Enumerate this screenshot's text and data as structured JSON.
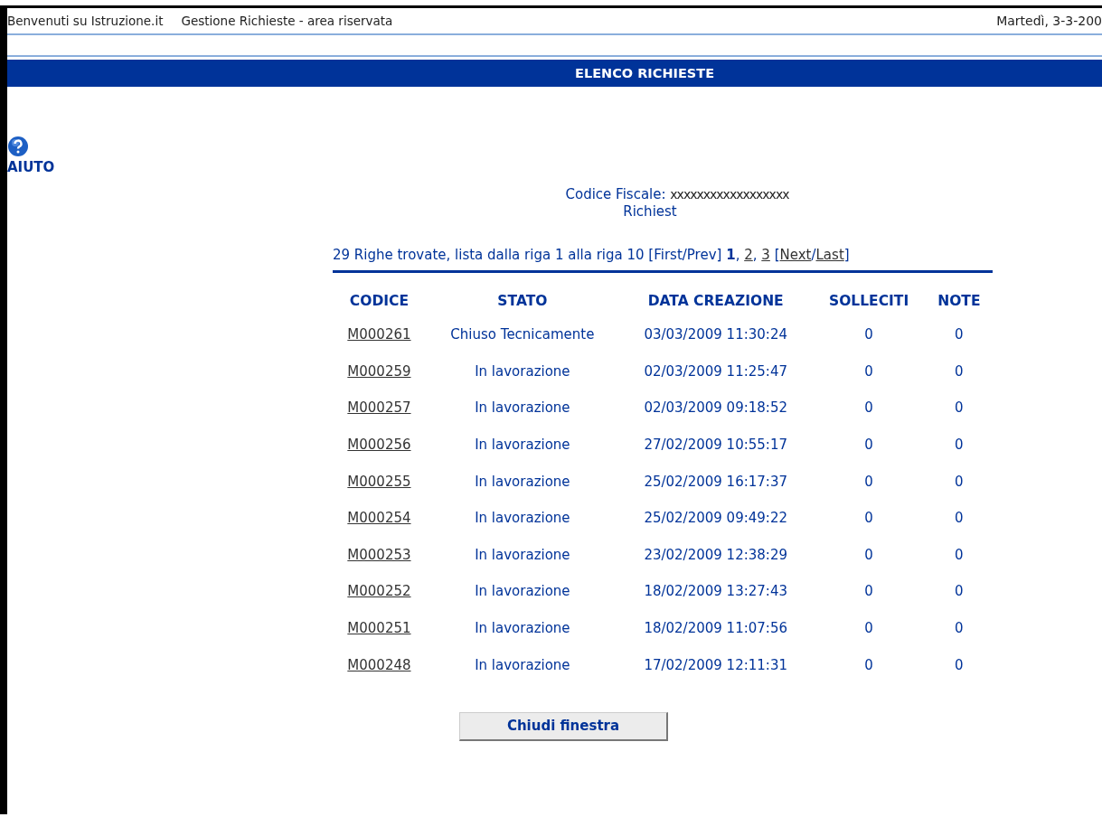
{
  "header": {
    "welcome": "Benvenuti su Istruzione.it",
    "section": "Gestione Richieste - area riservata",
    "date": "Martedì, 3-3-200"
  },
  "title_bar": "ELENCO RICHIESTE",
  "help": {
    "label": "AIUTO"
  },
  "codice_fiscale": {
    "label": "Codice Fiscale:",
    "value": "xxxxxxxxxxxxxxxxxx"
  },
  "subtitle": "Richiest",
  "pagination": {
    "summary": "29 Righe trovate, lista dalla riga 1 alla riga 10 [First/Prev]",
    "pages": [
      {
        "label": "1",
        "selected": true
      },
      {
        "label": "2",
        "selected": false
      },
      {
        "label": "3",
        "selected": false
      }
    ],
    "comma": ",",
    "open_bracket": "[",
    "next": "Next",
    "slash": "/",
    "last": "Last",
    "close_bracket": "]"
  },
  "table": {
    "columns": [
      "CODICE",
      "STATO",
      "DATA CREAZIONE",
      "SOLLECITI",
      "NOTE"
    ],
    "rows": [
      [
        "M000261",
        "Chiuso Tecnicamente",
        "03/03/2009 11:30:24",
        "0",
        "0"
      ],
      [
        "M000259",
        "In lavorazione",
        "02/03/2009 11:25:47",
        "0",
        "0"
      ],
      [
        "M000257",
        "In lavorazione",
        "02/03/2009 09:18:52",
        "0",
        "0"
      ],
      [
        "M000256",
        "In lavorazione",
        "27/02/2009 10:55:17",
        "0",
        "0"
      ],
      [
        "M000255",
        "In lavorazione",
        "25/02/2009 16:17:37",
        "0",
        "0"
      ],
      [
        "M000254",
        "In lavorazione",
        "25/02/2009 09:49:22",
        "0",
        "0"
      ],
      [
        "M000253",
        "In lavorazione",
        "23/02/2009 12:38:29",
        "0",
        "0"
      ],
      [
        "M000252",
        "In lavorazione",
        "18/02/2009 13:27:43",
        "0",
        "0"
      ],
      [
        "M000251",
        "In lavorazione",
        "18/02/2009 11:07:56",
        "0",
        "0"
      ],
      [
        "M000248",
        "In lavorazione",
        "17/02/2009 12:11:31",
        "0",
        "0"
      ]
    ]
  },
  "close_button": "Chiudi finestra"
}
